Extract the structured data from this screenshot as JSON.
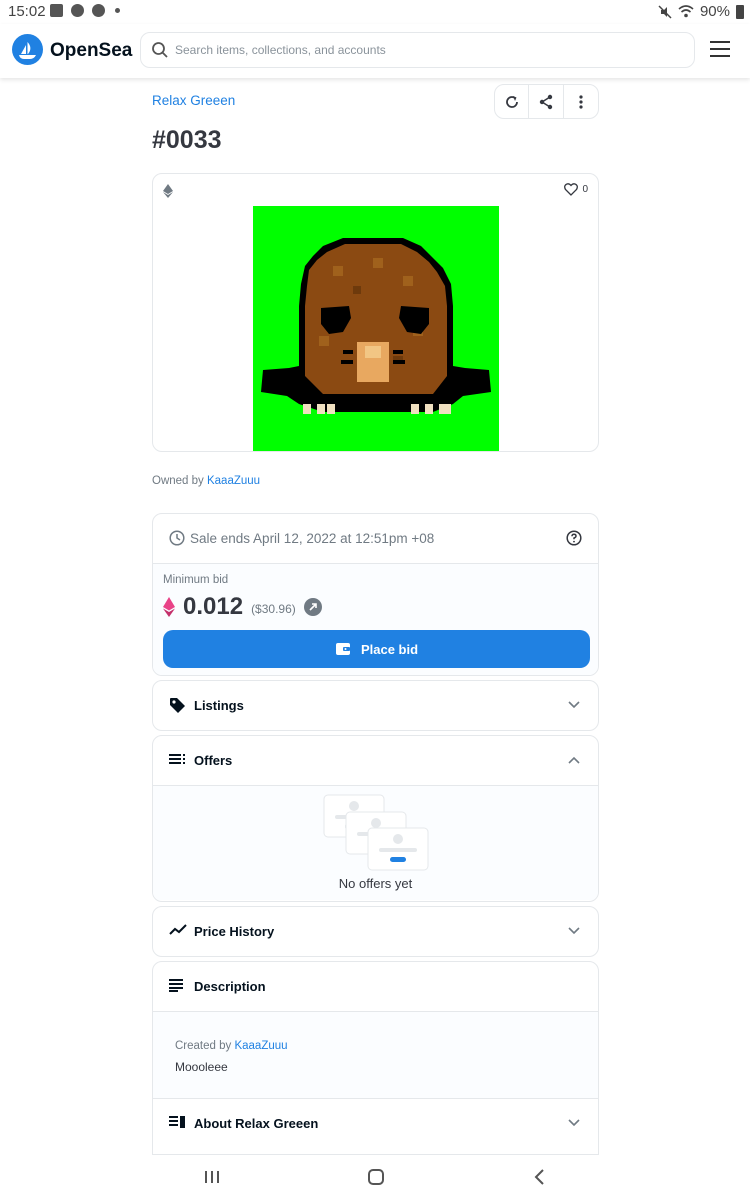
{
  "status_bar": {
    "time": "15:02",
    "battery": "90%"
  },
  "header": {
    "brand": "OpenSea",
    "search_placeholder": "Search items, collections, and accounts"
  },
  "item": {
    "collection": "Relax Greeen",
    "title": "#0033",
    "favorites": "0",
    "owned_prefix": "Owned by",
    "owner": "KaaaZuuu"
  },
  "sale": {
    "ends_text": "Sale ends April 12, 2022 at 12:51pm +08",
    "min_bid_label": "Minimum bid",
    "price": "0.012",
    "usd": "($30.96)",
    "button_label": "Place bid"
  },
  "panels": {
    "listings": "Listings",
    "offers": "Offers",
    "offers_empty": "No offers yet",
    "price_history": "Price History",
    "description": "Description",
    "created_prefix": "Created by",
    "creator": "KaaaZuuu",
    "description_text": "Moooleee",
    "about": "About Relax Greeen"
  },
  "colors": {
    "accent": "#2081e2",
    "nft_background": "#00ff00",
    "eth": "#e94287"
  }
}
